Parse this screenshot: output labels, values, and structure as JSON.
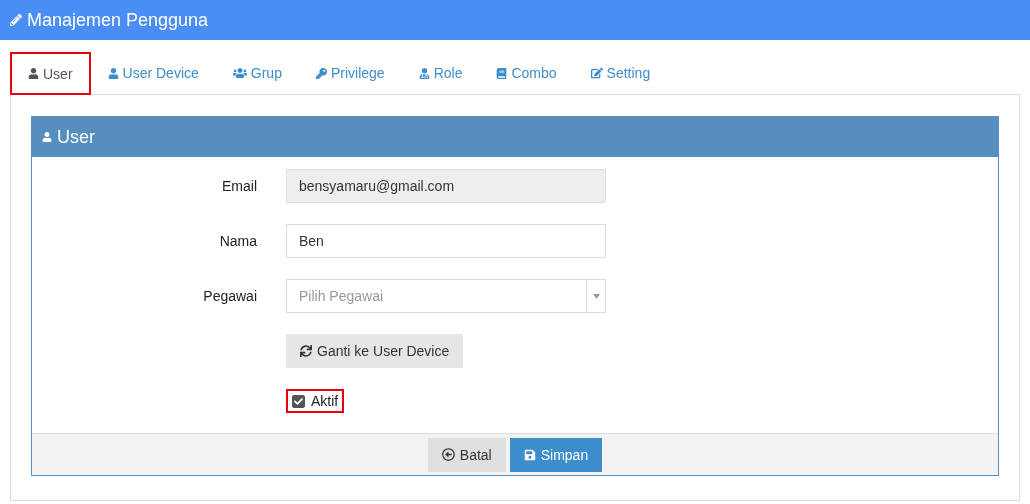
{
  "page_title": "Manajemen Pengguna",
  "tabs": [
    {
      "label": "User",
      "kind": "user",
      "selected": true,
      "highlighted": true
    },
    {
      "label": "User Device",
      "kind": "user",
      "selected": false,
      "highlighted": false
    },
    {
      "label": "Grup",
      "kind": "users",
      "selected": false,
      "highlighted": false
    },
    {
      "label": "Privilege",
      "kind": "key",
      "selected": false,
      "highlighted": false
    },
    {
      "label": "Role",
      "kind": "role",
      "selected": false,
      "highlighted": false
    },
    {
      "label": "Combo",
      "kind": "book",
      "selected": false,
      "highlighted": false
    },
    {
      "label": "Setting",
      "kind": "edit",
      "selected": false,
      "highlighted": false
    }
  ],
  "panel": {
    "title": "User",
    "fields": [
      {
        "kind": "readonly",
        "label": "Email",
        "value": "bensyamaru@gmail.com"
      },
      {
        "kind": "text",
        "label": "Nama",
        "value": "Ben"
      },
      {
        "kind": "select",
        "label": "Pegawai",
        "placeholder": "Pilih Pegawai"
      }
    ],
    "switch_button": "Ganti ke User Device",
    "checkbox": {
      "label": "Aktif",
      "checked": true,
      "highlighted": true
    },
    "buttons": [
      {
        "kind": "cancel",
        "label": "Batal"
      },
      {
        "kind": "save",
        "label": "Simpan"
      }
    ]
  }
}
